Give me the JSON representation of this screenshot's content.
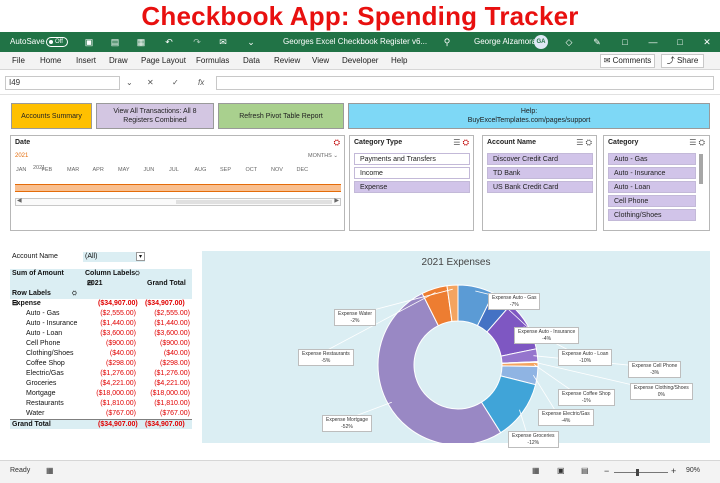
{
  "banner": {
    "title": "Checkbook App: Spending Tracker"
  },
  "titlebar": {
    "autosave_label": "AutoSave",
    "autosave_state": "Off",
    "document_title": "Georges Excel Checkbook Register v6...",
    "user_name": "George Alzamora",
    "user_initials": "GA"
  },
  "menubar": {
    "items": [
      "File",
      "Home",
      "Insert",
      "Draw",
      "Page Layout",
      "Formulas",
      "Data",
      "Review",
      "View",
      "Developer",
      "Help"
    ],
    "comments_label": "Comments",
    "share_label": "Share"
  },
  "formula_bar": {
    "cell_reference": "I49",
    "fx_label": "fx",
    "formula": ""
  },
  "buttons": {
    "accounts_summary": "Accounts Summary",
    "view_all": "View All Transactions: All 8 Registers Combined",
    "refresh_pivot": "Refresh Pivot Table Report",
    "help_line1": "Help:",
    "help_line2": "BuyExcelTemplates.com/pages/support"
  },
  "timeline": {
    "header": "Date",
    "selected_year": "2021",
    "period_label": "MONTHS",
    "year": "2021",
    "months": [
      "JAN",
      "FEB",
      "MAR",
      "APR",
      "MAY",
      "JUN",
      "JUL",
      "AUG",
      "SEP",
      "OCT",
      "NOV",
      "DEC"
    ]
  },
  "slicers": {
    "category_type": {
      "header": "Category Type",
      "items": [
        {
          "label": "Payments and Transfers",
          "selected": false
        },
        {
          "label": "Income",
          "selected": false
        },
        {
          "label": "Expense",
          "selected": true
        }
      ]
    },
    "account_name": {
      "header": "Account Name",
      "items": [
        {
          "label": "Discover Credit Card",
          "selected": true
        },
        {
          "label": "TD Bank",
          "selected": true
        },
        {
          "label": "US Bank Credit Card",
          "selected": true
        }
      ]
    },
    "category": {
      "header": "Category",
      "items": [
        {
          "label": "Auto - Gas",
          "selected": true
        },
        {
          "label": "Auto - Insurance",
          "selected": true
        },
        {
          "label": "Auto - Loan",
          "selected": true
        },
        {
          "label": "Cell Phone",
          "selected": true
        },
        {
          "label": "Clothing/Shoes",
          "selected": true
        }
      ]
    }
  },
  "pivot": {
    "filter_label": "Account Name",
    "filter_value": "(All)",
    "sum_label": "Sum of Amount",
    "column_labels": "Column Labels",
    "year": "2021",
    "grand_total_header": "Grand Total",
    "row_labels": "Row Labels",
    "expense_label": "Expense",
    "expense_value": "($34,907.00)",
    "expense_total": "($34,907.00)",
    "rows": [
      {
        "label": "Auto - Gas",
        "value": "($2,555.00)",
        "total": "($2,555.00)"
      },
      {
        "label": "Auto - Insurance",
        "value": "($1,440.00)",
        "total": "($1,440.00)"
      },
      {
        "label": "Auto - Loan",
        "value": "($3,600.00)",
        "total": "($3,600.00)"
      },
      {
        "label": "Cell Phone",
        "value": "($900.00)",
        "total": "($900.00)"
      },
      {
        "label": "Clothing/Shoes",
        "value": "($40.00)",
        "total": "($40.00)"
      },
      {
        "label": "Coffee Shop",
        "value": "($298.00)",
        "total": "($298.00)"
      },
      {
        "label": "Electric/Gas",
        "value": "($1,276.00)",
        "total": "($1,276.00)"
      },
      {
        "label": "Groceries",
        "value": "($4,221.00)",
        "total": "($4,221.00)"
      },
      {
        "label": "Mortgage",
        "value": "($18,000.00)",
        "total": "($18,000.00)"
      },
      {
        "label": "Restaurants",
        "value": "($1,810.00)",
        "total": "($1,810.00)"
      },
      {
        "label": "Water",
        "value": "($767.00)",
        "total": "($767.00)"
      }
    ],
    "grand_total_label": "Grand Total",
    "grand_total_value": "($34,907.00)",
    "grand_total_total": "($34,907.00)"
  },
  "chart_data": {
    "type": "pie",
    "variant": "doughnut",
    "title": "2021 Expenses",
    "slices": [
      {
        "label": "Expense Auto - Gas",
        "pct_label": "-7%",
        "value": 2555,
        "color": "#5b9bd5"
      },
      {
        "label": "Expense Auto - Insurance",
        "pct_label": "-4%",
        "value": 1440,
        "color": "#4472c4"
      },
      {
        "label": "Expense Auto - Loan",
        "pct_label": "-10%",
        "value": 3600,
        "color": "#7e57c2"
      },
      {
        "label": "Expense Cell Phone",
        "pct_label": "-3%",
        "value": 900,
        "color": "#9575cd"
      },
      {
        "label": "Expense Clothing/Shoes",
        "pct_label": "0%",
        "value": 40,
        "color": "#f0a050"
      },
      {
        "label": "Expense Coffee Shop",
        "pct_label": "-1%",
        "value": 298,
        "color": "#f4a460"
      },
      {
        "label": "Expense Electric/Gas",
        "pct_label": "-4%",
        "value": 1276,
        "color": "#8fb4e3"
      },
      {
        "label": "Expense Groceries",
        "pct_label": "-12%",
        "value": 4221,
        "color": "#40a4d8"
      },
      {
        "label": "Expense Mortgage",
        "pct_label": "-52%",
        "value": 18000,
        "color": "#9988c4"
      },
      {
        "label": "Expense Restaurants",
        "pct_label": "-5%",
        "value": 1810,
        "color": "#ed7d31"
      },
      {
        "label": "Expense Water",
        "pct_label": "-2%",
        "value": 767,
        "color": "#f4a460"
      }
    ],
    "legend": "none"
  },
  "statusbar": {
    "ready": "Ready",
    "zoom": "90%"
  }
}
